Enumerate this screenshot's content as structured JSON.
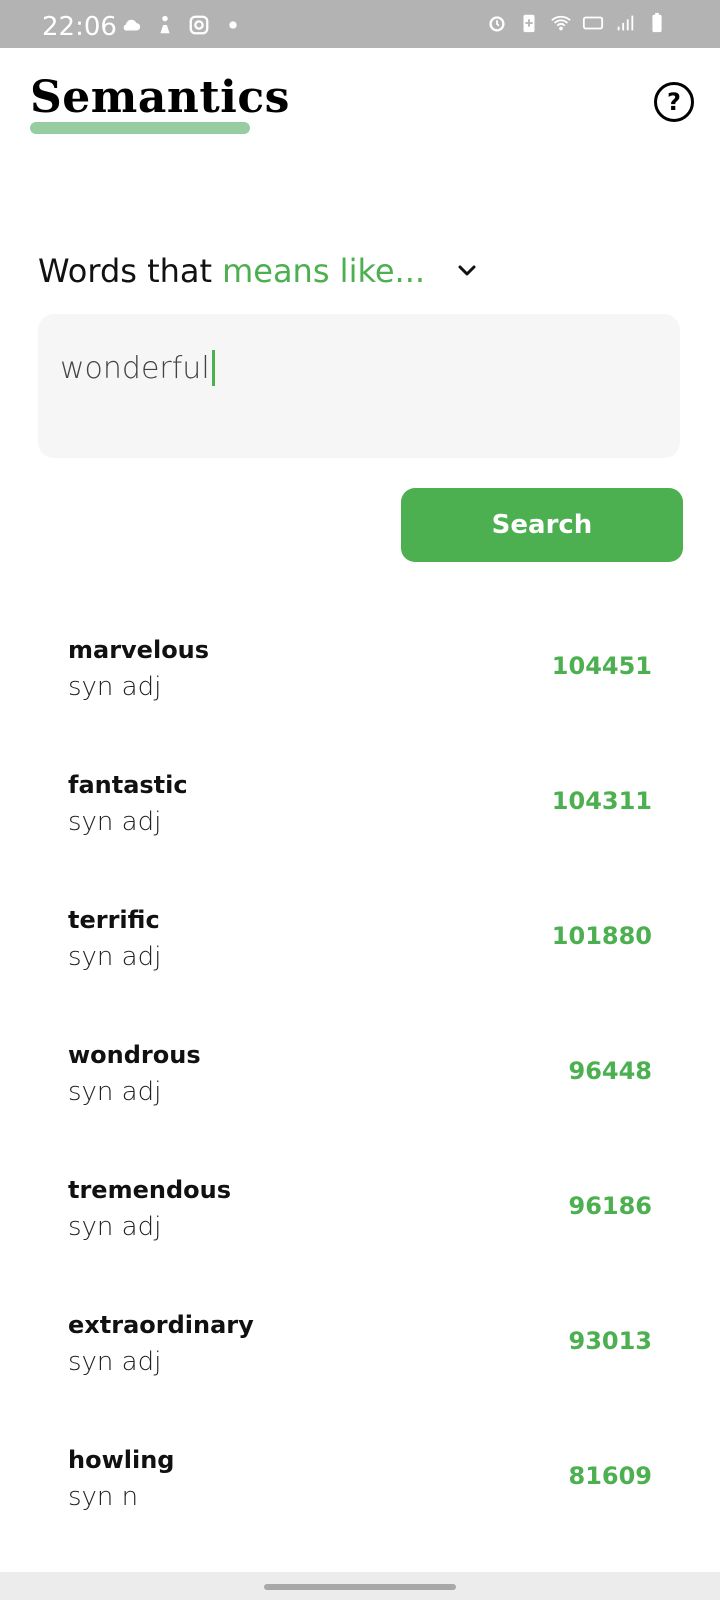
{
  "status_bar": {
    "time": "22:06",
    "left_icons": [
      "cloud-icon",
      "figure-icon",
      "instagram-icon",
      "dot-icon"
    ],
    "right_icons": [
      "alarm-icon",
      "battery-saver-icon",
      "wifi-icon",
      "volte-icon",
      "signal-icon",
      "battery-icon"
    ]
  },
  "header": {
    "title": "Semantics",
    "help_icon": "?"
  },
  "mode": {
    "prefix": "Words that",
    "selected": "means like...",
    "chevron": "chevron-down-icon"
  },
  "search": {
    "value": "wonderful",
    "button_label": "Search"
  },
  "results": [
    {
      "word": "marvelous",
      "tags": "syn adj",
      "score": "104451"
    },
    {
      "word": "fantastic",
      "tags": "syn adj",
      "score": "104311"
    },
    {
      "word": "terrific",
      "tags": "syn adj",
      "score": "101880"
    },
    {
      "word": "wondrous",
      "tags": "syn adj",
      "score": "96448"
    },
    {
      "word": "tremendous",
      "tags": "syn adj",
      "score": "96186"
    },
    {
      "word": "extraordinary",
      "tags": "syn adj",
      "score": "93013"
    },
    {
      "word": "howling",
      "tags": "syn n",
      "score": "81609"
    }
  ],
  "colors": {
    "accent": "#4caf50",
    "underline": "#97cda3",
    "input_bg": "#f6f6f6",
    "status_bar": "#b3b3b3"
  }
}
